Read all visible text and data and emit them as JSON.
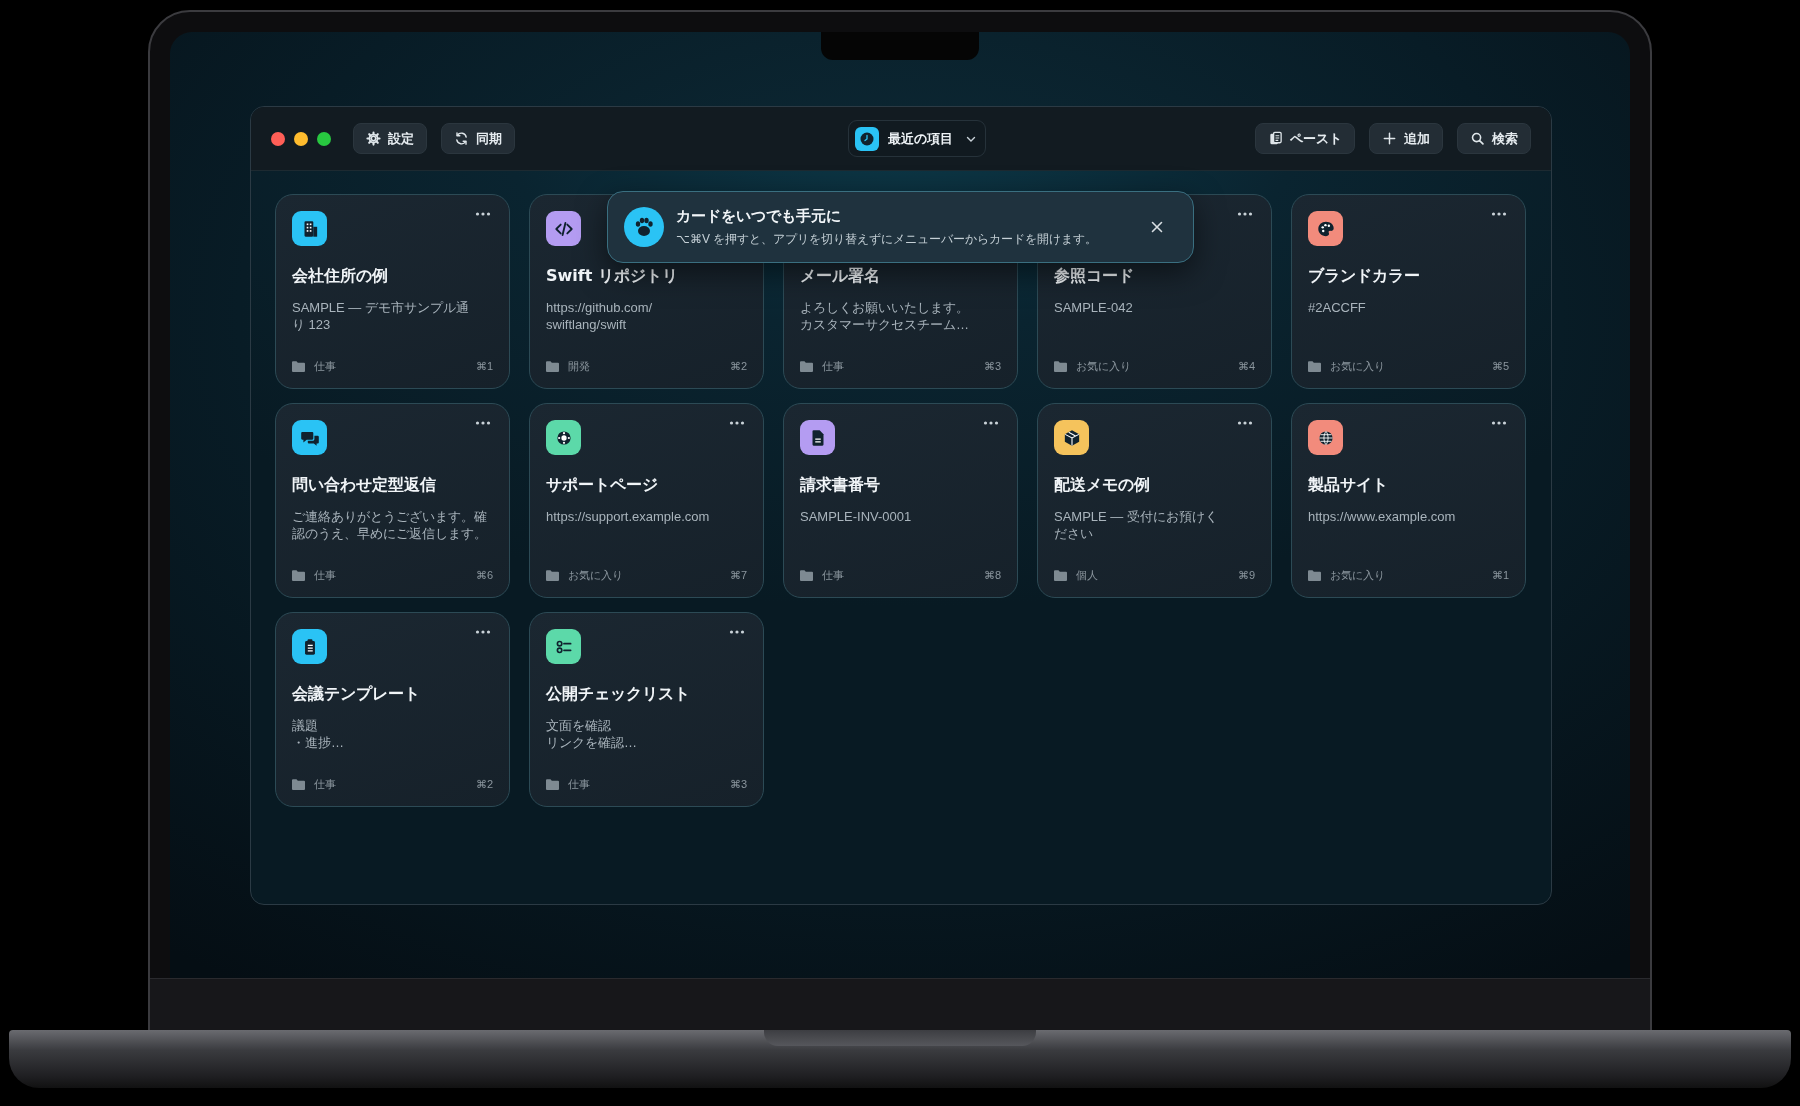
{
  "toolbar": {
    "left_buttons": [
      {
        "kind": "gear",
        "label": "設定"
      },
      {
        "kind": "sync",
        "label": "同期"
      }
    ],
    "view_menu": {
      "label": "最近の項目"
    },
    "right_buttons": [
      {
        "kind": "paste",
        "label": "ペースト"
      },
      {
        "kind": "plus",
        "label": "追加"
      },
      {
        "kind": "search",
        "label": "検索"
      }
    ]
  },
  "toast": {
    "title": "カードをいつでも手元に",
    "message": "⌥⌘V を押すと、アプリを切り替えずにメニューバーからカードを開けます。"
  },
  "cards": [
    {
      "kind": "building",
      "color": "#2ac3f5",
      "title": "会社住所の例",
      "lines": [
        "SAMPLE — デモ市サンプル通",
        "り 123"
      ],
      "category": "仕事",
      "shortcut": "⌘1"
    },
    {
      "kind": "code",
      "color": "#b49cf2",
      "menu_hidden": true,
      "title": "Swift リポジトリ",
      "lines": [
        "https://github.com/",
        "swiftlang/swift"
      ],
      "category": "開発",
      "shortcut": "⌘2"
    },
    {
      "menu_hidden": true,
      "title": "メール署名",
      "lines": [
        "よろしくお願いいたします。",
        "カスタマーサクセスチーム…"
      ],
      "category": "仕事",
      "shortcut": "⌘3"
    },
    {
      "title": "参照コード",
      "lines": [
        "SAMPLE-042"
      ],
      "category": "お気に入り",
      "shortcut": "⌘4"
    },
    {
      "kind": "palette",
      "color": "#f28b7c",
      "title": "ブランドカラー",
      "lines": [
        "#2ACCFF"
      ],
      "category": "お気に入り",
      "shortcut": "⌘5"
    },
    {
      "kind": "chat",
      "color": "#2ac3f5",
      "title": "問い合わせ定型返信",
      "lines": [
        "ご連絡ありがとうございます。確",
        "認のうえ、早めにご返信します。"
      ],
      "category": "仕事",
      "shortcut": "⌘6"
    },
    {
      "kind": "lifebuoy",
      "color": "#5cd9a9",
      "title": "サポートページ",
      "lines": [
        "https://support.example.com"
      ],
      "category": "お気に入り",
      "shortcut": "⌘7"
    },
    {
      "kind": "document",
      "color": "#b49cf2",
      "title": "請求書番号",
      "lines": [
        "SAMPLE-INV-0001"
      ],
      "category": "仕事",
      "shortcut": "⌘8"
    },
    {
      "kind": "box",
      "color": "#f5c35c",
      "title": "配送メモの例",
      "lines": [
        "SAMPLE — 受付にお預けく",
        "ださい"
      ],
      "category": "個人",
      "shortcut": "⌘9"
    },
    {
      "kind": "globe",
      "color": "#f28b7c",
      "title": "製品サイト",
      "lines": [
        "https://www.example.com"
      ],
      "category": "お気に入り",
      "shortcut": "⌘1"
    },
    {
      "kind": "clipboard",
      "color": "#2ac3f5",
      "title": "会議テンプレート",
      "lines": [
        "議題",
        "・進捗…"
      ],
      "category": "仕事",
      "shortcut": "⌘2"
    },
    {
      "kind": "checklist",
      "color": "#5cd9a9",
      "title": "公開チェックリスト",
      "lines": [
        "文面を確認",
        "リンクを確認…"
      ],
      "category": "仕事",
      "shortcut": "⌘3"
    }
  ]
}
